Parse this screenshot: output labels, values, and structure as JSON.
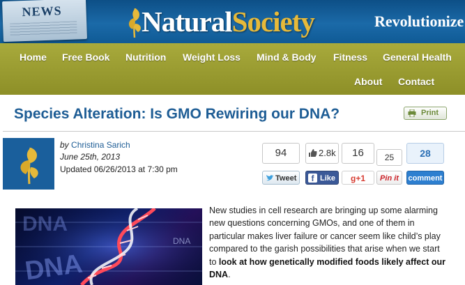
{
  "header": {
    "news_badge": "NEWS",
    "logo_natural": "Natural",
    "logo_society": "Society",
    "tagline": "Revolutionize Y"
  },
  "nav": {
    "items": [
      "Home",
      "Free Book",
      "Nutrition",
      "Weight Loss",
      "Mind & Body",
      "Fitness",
      "General Health",
      "About",
      "Contact"
    ]
  },
  "article": {
    "title": "Species Alteration: Is GMO Rewiring our DNA?",
    "print_label": "Print",
    "by_prefix": "by",
    "author": "Christina Sarich",
    "date": "June 25th, 2013",
    "updated": "Updated 06/26/2013 at 7:30 pm",
    "body_normal": "New studies in cell research are bringing up some alarming new questions concerning GMOs, and one of them in particular makes liver failure or cancer seem like child’s play compared to the garish possibilities that arise when we start to ",
    "body_bold": "look at how genetically modified foods likely affect our DNA",
    "body_end": "."
  },
  "social": {
    "tweet_count": "94",
    "tweet_label": "Tweet",
    "fb_count": "2.8k",
    "fb_label": "Like",
    "gplus_count": "16",
    "gplus_label": "+1",
    "pin_count": "25",
    "pin_label": "Pin it",
    "comment_count": "28",
    "comment_label": "comment"
  },
  "photo": {
    "dna_label": "DNA"
  },
  "colors": {
    "header_blue": "#1b6aa8",
    "nav_olive": "#9b9d33",
    "title_blue": "#1e5d95",
    "logo_gold": "#e6b93a",
    "facebook_blue": "#3b5998",
    "comment_blue": "#2d7fd0"
  }
}
